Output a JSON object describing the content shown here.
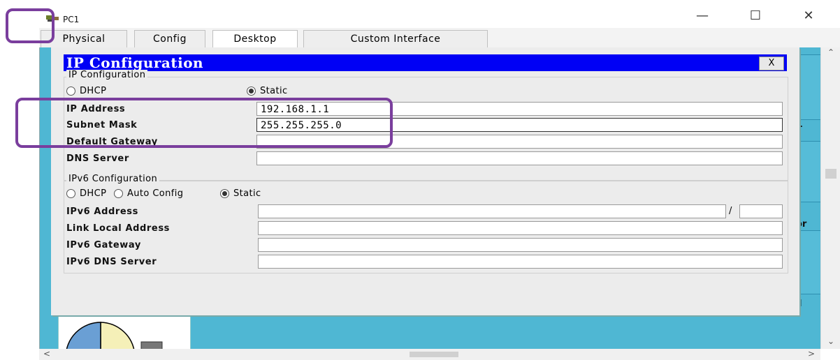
{
  "window": {
    "title": "PC1",
    "min_glyph": "—",
    "max_glyph": "☐",
    "close_glyph": "✕"
  },
  "tabs": [
    {
      "label": "Physical"
    },
    {
      "label": "Config"
    },
    {
      "label": "Desktop"
    },
    {
      "label": "Custom Interface"
    }
  ],
  "dialog": {
    "title": "IP Configuration",
    "close_label": "X",
    "ipv4": {
      "group_label": "IP Configuration",
      "dhcp_label": "DHCP",
      "static_label": "Static",
      "mode": "Static",
      "ip_address_label": "IP Address",
      "ip_address_value": "192.168.1.1",
      "subnet_mask_label": "Subnet Mask",
      "subnet_mask_value": "255.255.255.0",
      "default_gateway_label": "Default Gateway",
      "default_gateway_value": "",
      "dns_server_label": "DNS Server",
      "dns_server_value": ""
    },
    "ipv6": {
      "group_label": "IPv6 Configuration",
      "dhcp_label": "DHCP",
      "auto_label": "Auto Config",
      "static_label": "Static",
      "mode": "Static",
      "address_label": "IPv6 Address",
      "address_value": "",
      "prefix_sep": "/",
      "prefix_value": "",
      "link_local_label": "Link Local Address",
      "link_local_value": "",
      "gateway_label": "IPv6 Gateway",
      "gateway_value": "",
      "dns_label": "IPv6 DNS Server",
      "dns_value": ""
    }
  },
  "desktop_ghost_text": [
    "or",
    "-",
    "l"
  ],
  "colors": {
    "desktop_bg": "#4fb7d3",
    "dialog_title_bg": "#0000f5",
    "highlight": "#7a3e9d"
  }
}
